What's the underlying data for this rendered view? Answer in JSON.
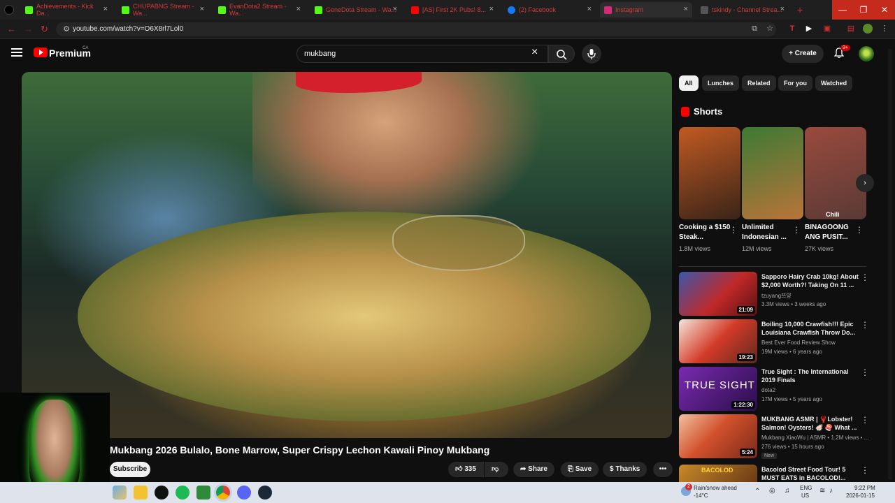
{
  "browser": {
    "tabs": [
      {
        "title": "Achievements - Kick Da...",
        "color": "#53fc18"
      },
      {
        "title": "CHUPABNG Stream - Wa...",
        "color": "#53fc18"
      },
      {
        "title": "EvanDota2 Stream - Wa...",
        "color": "#53fc18"
      },
      {
        "title": "GeneDota Stream - Wa...",
        "color": "#53fc18"
      },
      {
        "title": "[AS] First 2K Pubs! 8...",
        "color": "#ff0000"
      },
      {
        "title": "(2) Facebook",
        "color": "#1877f2"
      },
      {
        "title": "Instagram",
        "color": "#d62976"
      },
      {
        "title": "tskindy - Channel Strea...",
        "color": "#555555"
      }
    ],
    "url": "youtube.com/watch?v=O6X8rl7Lol0",
    "new_tab": "+",
    "win_min": "—",
    "win_max": "❐",
    "win_close": "✕"
  },
  "header": {
    "brand": "Premium",
    "country": "CA",
    "search_query": "mukbang",
    "create_label": "Create",
    "notification_count": "9+"
  },
  "video": {
    "title": "Mukbang 2026 Bulalo, Bone Marrow, Super Crispy Lechon Kawali Pinoy Mukbang",
    "subscribe_label": "Subscribe",
    "like_count": "335",
    "share_label": "Share",
    "save_label": "Save",
    "thanks_label": "Thanks",
    "more": "•••"
  },
  "filters": [
    "All",
    "Lunches",
    "Related",
    "For you",
    "Watched"
  ],
  "shorts": {
    "heading": "Shorts",
    "items": [
      {
        "title": "Cooking a $150 Steak...",
        "views": "1.8M views",
        "colors": [
          "#c15a22",
          "#3a2418"
        ]
      },
      {
        "title": "Unlimited Indonesian ...",
        "views": "12M views",
        "colors": [
          "#3d7a34",
          "#b9743a"
        ]
      },
      {
        "title": "BINAGOONG ANG PUSIT...",
        "views": "27K views",
        "colors": [
          "#9a4a3e",
          "#5a3a35"
        ]
      }
    ],
    "overlay_text": "Chili"
  },
  "recommendations": [
    {
      "title": "Sapporo Hairy Crab 10kg! About $2,000 Worth?! Taking On 11 ...",
      "channel": "tzuyang쯔양",
      "meta": "3.3M views • 3 weeks ago",
      "duration": "21:09",
      "colors": [
        "#c0292a",
        "#3a57a8"
      ]
    },
    {
      "title": "Boiling 10,000 Crawfish!!! Epic Louisiana Crawfish Throw Do...",
      "channel": "Best Ever Food Review Show",
      "meta": "19M views • 6 years ago",
      "duration": "19:23",
      "colors": [
        "#d33a28",
        "#5e2a20"
      ]
    },
    {
      "title": "True Sight : The International 2019 Finals",
      "channel": "dota2",
      "meta": "17M views • 5 years ago",
      "duration": "1:22:30",
      "colors": [
        "#5a1e8a",
        "#2a0e4a"
      ],
      "overlay": "TRUE SIGHT"
    },
    {
      "title": "MUKBANG ASMR | 🦞Lobster! Salmon! Oysters! 🦪 🍣 What ...",
      "channel": "Mukbang XiaoWu | ASMR • 1.2M views • ...",
      "meta": "276 views • 15 hours ago",
      "duration": "5:24",
      "colors": [
        "#d1502b",
        "#7a2a1a"
      ],
      "badge": "New"
    },
    {
      "title": "Bacolod Street Food Tour! 5 MUST EATS in BACOLOD!...",
      "channel": "",
      "meta": "",
      "duration": "",
      "colors": [
        "#c98a2a",
        "#6a3a15"
      ],
      "overlay": "BACOLOD"
    }
  ],
  "taskbar": {
    "weather_line1": "Rain/snow ahead",
    "weather_line2": "-14°C",
    "weather_badge": "2",
    "lang_line1": "ENG",
    "lang_line2": "US",
    "time": "9:22 PM",
    "date": "2026-01-15"
  }
}
